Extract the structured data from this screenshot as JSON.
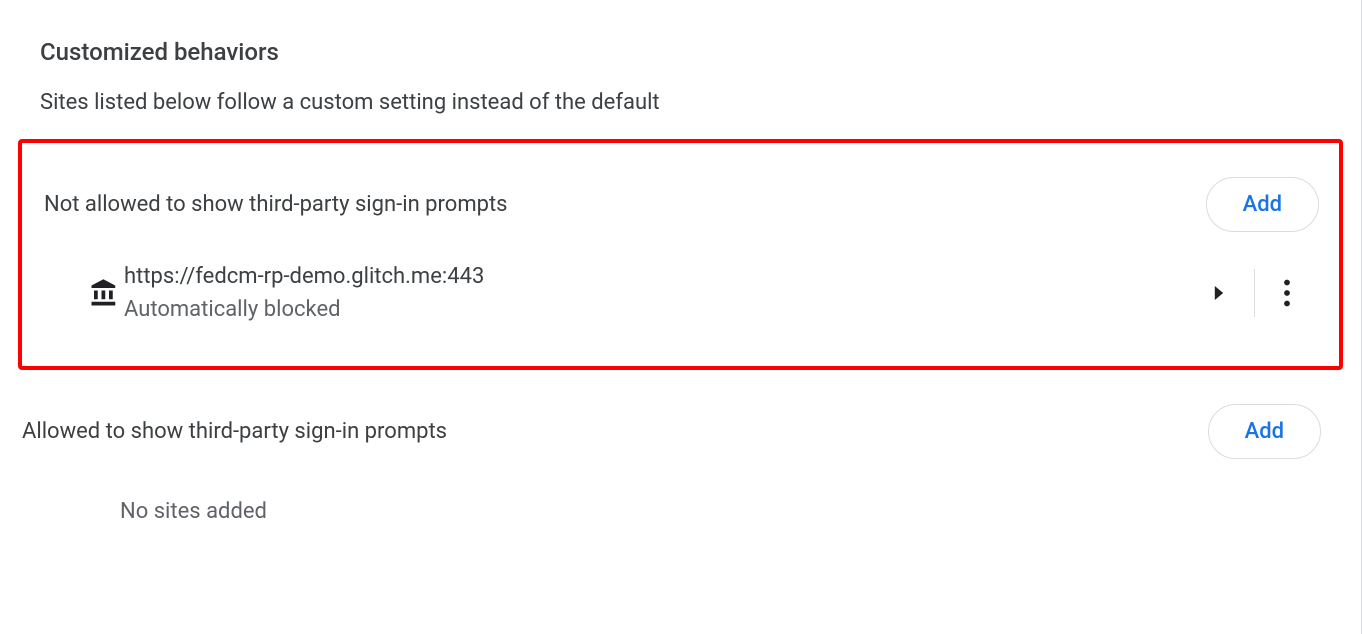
{
  "heading": "Customized behaviors",
  "description": "Sites listed below follow a custom setting instead of the default",
  "notAllowed": {
    "title": "Not allowed to show third-party sign-in prompts",
    "addLabel": "Add",
    "sites": [
      {
        "url": "https://fedcm-rp-demo.glitch.me:443",
        "status": "Automatically blocked"
      }
    ]
  },
  "allowed": {
    "title": "Allowed to show third-party sign-in prompts",
    "addLabel": "Add",
    "emptyText": "No sites added"
  }
}
